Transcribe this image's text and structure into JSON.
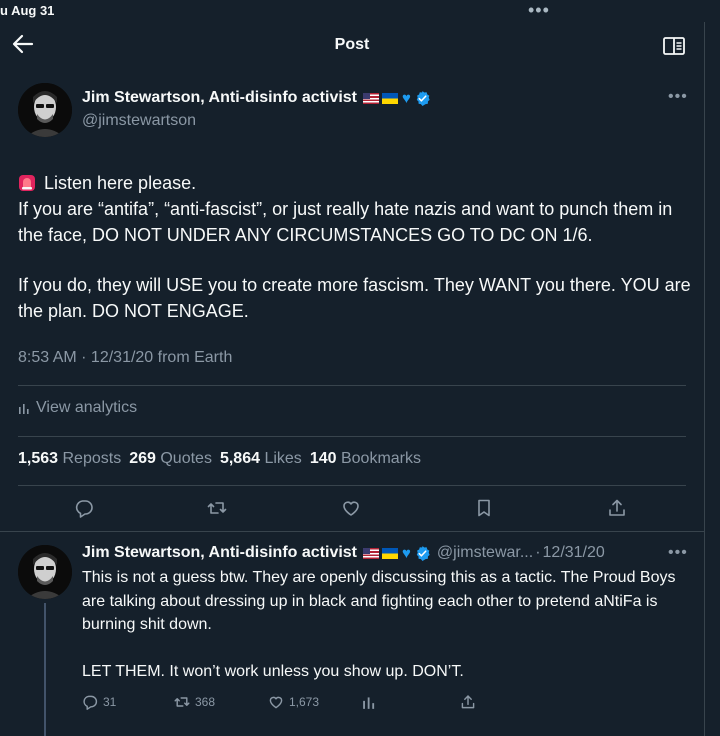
{
  "status_bar": {
    "time": "u Aug 31"
  },
  "nav": {
    "title": "Post"
  },
  "main_post": {
    "author_name": "Jim Stewartson, Anti-disinfo activist",
    "handle": "@jimstewartson",
    "text_line1": "Listen here please.",
    "text_line2": "If you are “antifa”, “anti-fascist”, or just really hate nazis and want to punch them in the face, DO NOT UNDER ANY CIRCUMSTANCES GO TO DC ON 1/6.",
    "text_line3": "If you do, they will USE you to create more fascism. They WANT you there. YOU are the plan. DO NOT ENGAGE.",
    "timestamp": "8:53 AM · 12/31/20 from Earth",
    "analytics_label": "View analytics",
    "stats": [
      {
        "count": "1,563",
        "label": "Reposts"
      },
      {
        "count": "269",
        "label": "Quotes"
      },
      {
        "count": "5,864",
        "label": "Likes"
      },
      {
        "count": "140",
        "label": "Bookmarks"
      }
    ]
  },
  "reply": {
    "author_name": "Jim Stewartson, Anti-disinfo activist",
    "handle": "@jimstewar...",
    "separator": "·",
    "date": "12/31/20",
    "paragraph1": "This is not a guess btw. They are openly discussing this as a tactic. The Proud Boys are talking about dressing up in black and fighting each other to pretend aNtiFa is burning shit down.",
    "paragraph2": "LET THEM. It won’t work unless you show up. DON’T.",
    "replies": "31",
    "reposts": "368",
    "likes": "1,673"
  },
  "icons": {
    "back": "arrow-left-icon",
    "reader": "reader-mode-icon",
    "siren": "rotating-light-icon",
    "verified": "verified-badge-icon",
    "reply": "comment-icon",
    "repost": "retweet-icon",
    "like": "heart-icon",
    "bookmark": "bookmark-icon",
    "share": "share-icon",
    "analytics": "bar-chart-icon"
  },
  "colors": {
    "background": "#15202b",
    "text": "#f7f9f9",
    "secondary_text": "#8b98a5",
    "accent": "#1d9bf0",
    "divider": "#38444d"
  }
}
